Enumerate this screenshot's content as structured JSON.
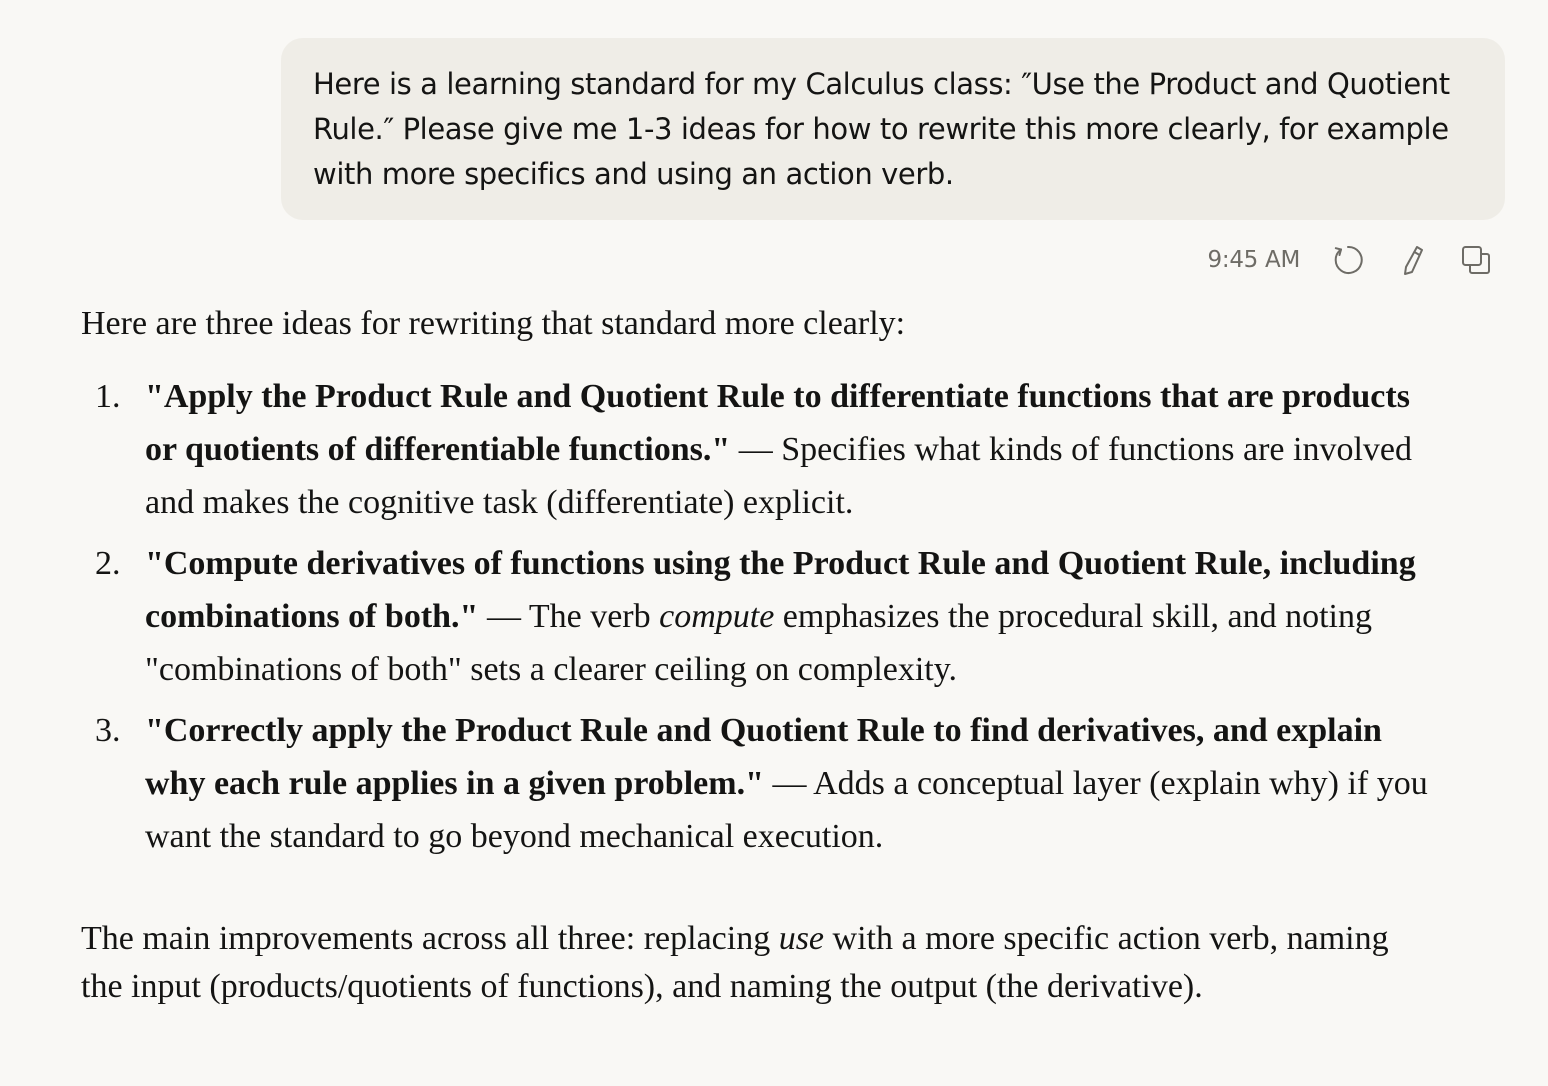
{
  "user_message": {
    "text": "Here is a learning standard for my Calculus class: ″Use the Product and Quotient Rule.″ Please give me 1-3 ideas for how to rewrite this more clearly, for example with more specifics and using an action verb."
  },
  "message_meta": {
    "timestamp": "9:45 AM",
    "actions": [
      {
        "icon": "retry-icon"
      },
      {
        "icon": "edit-icon"
      },
      {
        "icon": "copy-icon"
      }
    ]
  },
  "response": {
    "intro": "Here are three ideas for rewriting that standard more clearly:",
    "ideas": [
      {
        "number": "1.",
        "bold": "\"Apply the Product Rule and Quotient Rule to differentiate functions that are products or quotients of differentiable functions.\"",
        "dash": " — ",
        "text_before": "Specifies what kinds of functions are involved and makes the cognitive task (differentiate) explicit.",
        "italic": "",
        "text_after": ""
      },
      {
        "number": "2.",
        "bold": "\"Compute derivatives of functions using the Product Rule and Quotient Rule, including combinations of both.\"",
        "dash": " — ",
        "text_before": "The verb ",
        "italic": "compute",
        "text_after": " emphasizes the procedural skill, and noting \"combinations of both\" sets a clearer ceiling on complexity."
      },
      {
        "number": "3.",
        "bold": "\"Correctly apply the Product Rule and Quotient Rule to find derivatives, and explain why each rule applies in a given problem.\"",
        "dash": " — ",
        "text_before": "Adds a conceptual layer (explain why) if you want the standard to go beyond mechanical execution.",
        "italic": "",
        "text_after": ""
      }
    ],
    "closing": {
      "before": "The main improvements across all three: replacing ",
      "italic": "use",
      "after": " with a more specific action verb, naming the input (products/quotients of functions), and naming the output (the derivative)."
    }
  }
}
